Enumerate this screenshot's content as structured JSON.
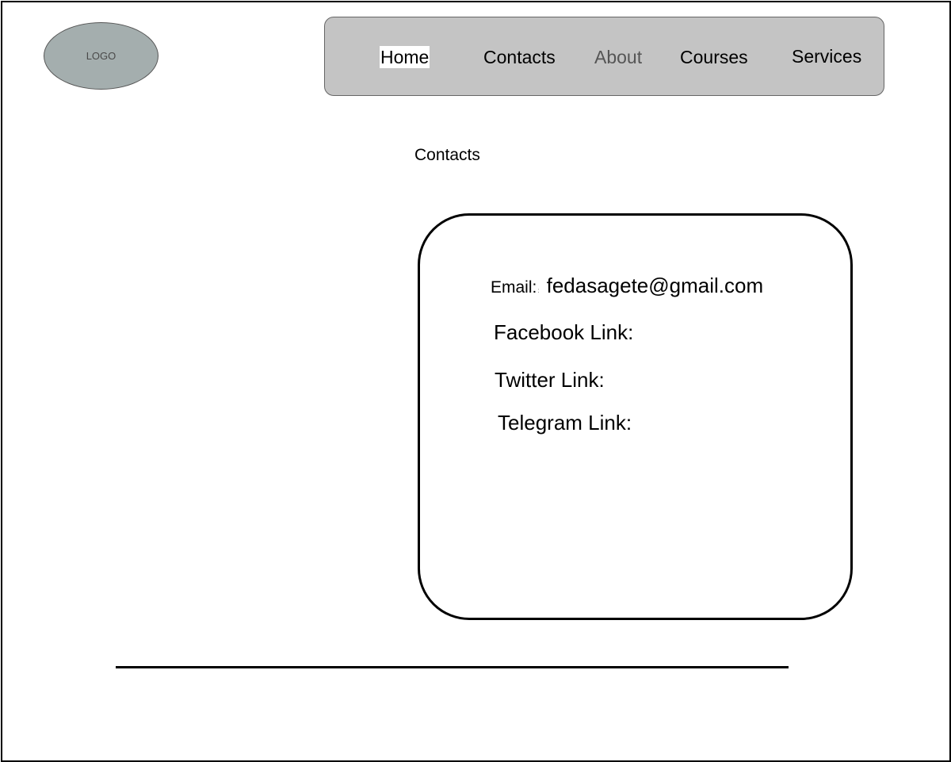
{
  "logo": {
    "label": "LOGO"
  },
  "nav": {
    "items": [
      {
        "label": "Home"
      },
      {
        "label": "Contacts"
      },
      {
        "label": "About"
      },
      {
        "label": "Courses"
      },
      {
        "label": "Services"
      }
    ]
  },
  "main": {
    "heading": "Contacts",
    "card": {
      "email_label": "Email:",
      "email_separator": ":",
      "email_value": "fedasagete@gmail.com",
      "facebook_label": "Facebook Link:",
      "twitter_label": "Twitter Link:",
      "telegram_label": "Telegram Link:"
    }
  },
  "colors": {
    "logo_fill": "#a4aeae",
    "navbar_fill": "#c4c4c4",
    "about_text": "#555555",
    "border": "#000000"
  }
}
